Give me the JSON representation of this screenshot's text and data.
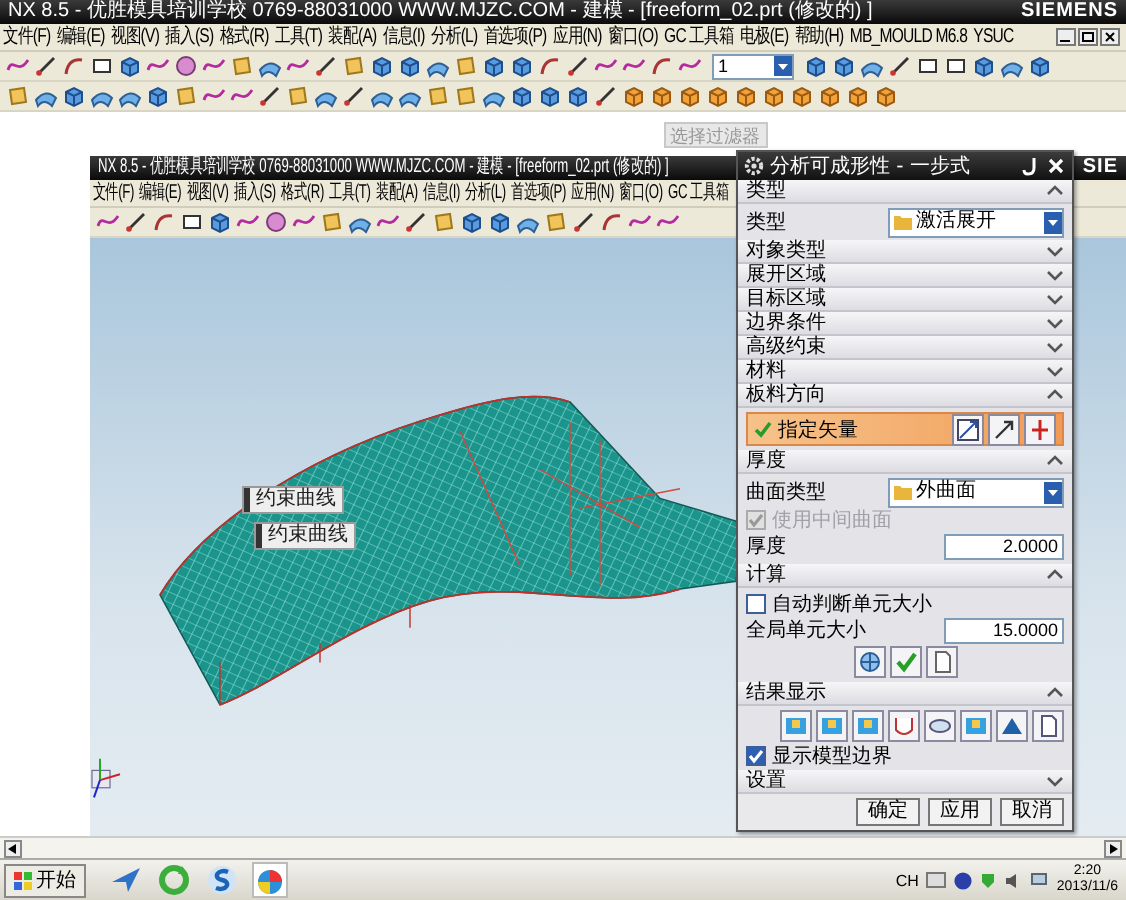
{
  "app_window": {
    "title": "NX 8.5 - 优胜模具培训学校 0769-88031000 WWW.MJZC.COM - 建模 - [freeform_02.prt (修改的) ]",
    "brand": "SIEMENS",
    "menu": [
      "文件(F)",
      "编辑(E)",
      "视图(V)",
      "插入(S)",
      "格式(R)",
      "工具(T)",
      "装配(A)",
      "信息(I)",
      "分析(L)",
      "首选项(P)",
      "应用(N)",
      "窗口(O)",
      "GC 工具箱",
      "电极(E)",
      "帮助(H)",
      "MB_MOULD M6.8",
      "YSUC"
    ],
    "layer_dropdown": {
      "value": "1"
    }
  },
  "selection_filter": {
    "placeholder": "选择过滤器"
  },
  "inner_window": {
    "title": "NX 8.5 - 优胜模具培训学校 0769-88031000 WWW.MJZC.COM - 建模 - [freeform_02.prt (修改的) ]",
    "brand": "SIE",
    "menu": [
      "文件(F)",
      "编辑(E)",
      "视图(V)",
      "插入(S)",
      "格式(R)",
      "工具(T)",
      "装配(A)",
      "信息(I)",
      "分析(L)",
      "首选项(P)",
      "应用(N)",
      "窗口(O)",
      "GC 工具箱"
    ]
  },
  "view_labels": [
    "约束曲线",
    "约束曲线"
  ],
  "dialog": {
    "title": "分析可成形性 - 一步式",
    "sections": [
      {
        "title": "类型",
        "expanded": true,
        "controls": [
          {
            "kind": "dropdown",
            "label": "类型",
            "value": "激活展开"
          }
        ]
      },
      {
        "title": "对象类型",
        "expanded": false
      },
      {
        "title": "展开区域",
        "expanded": false
      },
      {
        "title": "目标区域",
        "expanded": false
      },
      {
        "title": "边界条件",
        "expanded": false
      },
      {
        "title": "高级约束",
        "expanded": false
      },
      {
        "title": "材料",
        "expanded": false
      },
      {
        "title": "板料方向",
        "expanded": true,
        "controls": [
          {
            "kind": "vector",
            "label": "指定矢量"
          }
        ]
      },
      {
        "title": "厚度",
        "expanded": true,
        "controls": [
          {
            "kind": "dropdown",
            "label": "曲面类型",
            "value": "外曲面"
          },
          {
            "kind": "checkbox",
            "label": "使用中间曲面",
            "checked": true,
            "disabled": true
          },
          {
            "kind": "number",
            "label": "厚度",
            "value": "2.0000"
          }
        ]
      },
      {
        "title": "计算",
        "expanded": true,
        "controls": [
          {
            "kind": "checkbox",
            "label": "自动判断单元大小",
            "checked": false,
            "disabled": false
          },
          {
            "kind": "number",
            "label": "全局单元大小",
            "value": "15.0000"
          },
          {
            "kind": "solver_buttons"
          }
        ]
      },
      {
        "title": "结果显示",
        "expanded": true,
        "controls": [
          {
            "kind": "display_buttons"
          },
          {
            "kind": "checkbox",
            "label": "显示模型边界",
            "checked": true,
            "disabled": false
          }
        ]
      },
      {
        "title": "设置",
        "expanded": false
      }
    ],
    "buttons": [
      "确定",
      "应用",
      "取消"
    ]
  },
  "taskbar": {
    "start": "开始",
    "language": "CH",
    "time": "2:20",
    "date": "2013/11/6"
  }
}
